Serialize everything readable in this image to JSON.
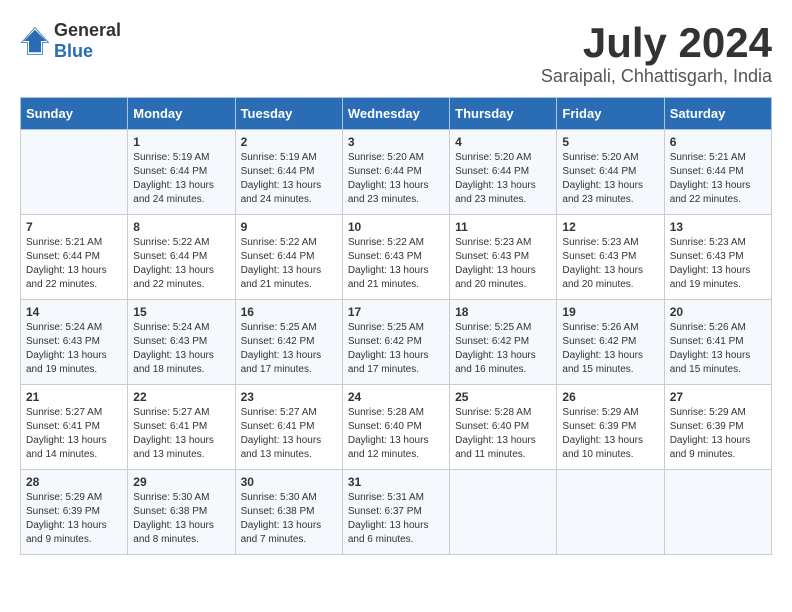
{
  "header": {
    "logo_general": "General",
    "logo_blue": "Blue",
    "month_year": "July 2024",
    "location": "Saraipali, Chhattisgarh, India"
  },
  "days_of_week": [
    "Sunday",
    "Monday",
    "Tuesday",
    "Wednesday",
    "Thursday",
    "Friday",
    "Saturday"
  ],
  "weeks": [
    [
      {
        "day": "",
        "info": ""
      },
      {
        "day": "1",
        "info": "Sunrise: 5:19 AM\nSunset: 6:44 PM\nDaylight: 13 hours\nand 24 minutes."
      },
      {
        "day": "2",
        "info": "Sunrise: 5:19 AM\nSunset: 6:44 PM\nDaylight: 13 hours\nand 24 minutes."
      },
      {
        "day": "3",
        "info": "Sunrise: 5:20 AM\nSunset: 6:44 PM\nDaylight: 13 hours\nand 23 minutes."
      },
      {
        "day": "4",
        "info": "Sunrise: 5:20 AM\nSunset: 6:44 PM\nDaylight: 13 hours\nand 23 minutes."
      },
      {
        "day": "5",
        "info": "Sunrise: 5:20 AM\nSunset: 6:44 PM\nDaylight: 13 hours\nand 23 minutes."
      },
      {
        "day": "6",
        "info": "Sunrise: 5:21 AM\nSunset: 6:44 PM\nDaylight: 13 hours\nand 22 minutes."
      }
    ],
    [
      {
        "day": "7",
        "info": "Sunrise: 5:21 AM\nSunset: 6:44 PM\nDaylight: 13 hours\nand 22 minutes."
      },
      {
        "day": "8",
        "info": "Sunrise: 5:22 AM\nSunset: 6:44 PM\nDaylight: 13 hours\nand 22 minutes."
      },
      {
        "day": "9",
        "info": "Sunrise: 5:22 AM\nSunset: 6:44 PM\nDaylight: 13 hours\nand 21 minutes."
      },
      {
        "day": "10",
        "info": "Sunrise: 5:22 AM\nSunset: 6:43 PM\nDaylight: 13 hours\nand 21 minutes."
      },
      {
        "day": "11",
        "info": "Sunrise: 5:23 AM\nSunset: 6:43 PM\nDaylight: 13 hours\nand 20 minutes."
      },
      {
        "day": "12",
        "info": "Sunrise: 5:23 AM\nSunset: 6:43 PM\nDaylight: 13 hours\nand 20 minutes."
      },
      {
        "day": "13",
        "info": "Sunrise: 5:23 AM\nSunset: 6:43 PM\nDaylight: 13 hours\nand 19 minutes."
      }
    ],
    [
      {
        "day": "14",
        "info": "Sunrise: 5:24 AM\nSunset: 6:43 PM\nDaylight: 13 hours\nand 19 minutes."
      },
      {
        "day": "15",
        "info": "Sunrise: 5:24 AM\nSunset: 6:43 PM\nDaylight: 13 hours\nand 18 minutes."
      },
      {
        "day": "16",
        "info": "Sunrise: 5:25 AM\nSunset: 6:42 PM\nDaylight: 13 hours\nand 17 minutes."
      },
      {
        "day": "17",
        "info": "Sunrise: 5:25 AM\nSunset: 6:42 PM\nDaylight: 13 hours\nand 17 minutes."
      },
      {
        "day": "18",
        "info": "Sunrise: 5:25 AM\nSunset: 6:42 PM\nDaylight: 13 hours\nand 16 minutes."
      },
      {
        "day": "19",
        "info": "Sunrise: 5:26 AM\nSunset: 6:42 PM\nDaylight: 13 hours\nand 15 minutes."
      },
      {
        "day": "20",
        "info": "Sunrise: 5:26 AM\nSunset: 6:41 PM\nDaylight: 13 hours\nand 15 minutes."
      }
    ],
    [
      {
        "day": "21",
        "info": "Sunrise: 5:27 AM\nSunset: 6:41 PM\nDaylight: 13 hours\nand 14 minutes."
      },
      {
        "day": "22",
        "info": "Sunrise: 5:27 AM\nSunset: 6:41 PM\nDaylight: 13 hours\nand 13 minutes."
      },
      {
        "day": "23",
        "info": "Sunrise: 5:27 AM\nSunset: 6:41 PM\nDaylight: 13 hours\nand 13 minutes."
      },
      {
        "day": "24",
        "info": "Sunrise: 5:28 AM\nSunset: 6:40 PM\nDaylight: 13 hours\nand 12 minutes."
      },
      {
        "day": "25",
        "info": "Sunrise: 5:28 AM\nSunset: 6:40 PM\nDaylight: 13 hours\nand 11 minutes."
      },
      {
        "day": "26",
        "info": "Sunrise: 5:29 AM\nSunset: 6:39 PM\nDaylight: 13 hours\nand 10 minutes."
      },
      {
        "day": "27",
        "info": "Sunrise: 5:29 AM\nSunset: 6:39 PM\nDaylight: 13 hours\nand 9 minutes."
      }
    ],
    [
      {
        "day": "28",
        "info": "Sunrise: 5:29 AM\nSunset: 6:39 PM\nDaylight: 13 hours\nand 9 minutes."
      },
      {
        "day": "29",
        "info": "Sunrise: 5:30 AM\nSunset: 6:38 PM\nDaylight: 13 hours\nand 8 minutes."
      },
      {
        "day": "30",
        "info": "Sunrise: 5:30 AM\nSunset: 6:38 PM\nDaylight: 13 hours\nand 7 minutes."
      },
      {
        "day": "31",
        "info": "Sunrise: 5:31 AM\nSunset: 6:37 PM\nDaylight: 13 hours\nand 6 minutes."
      },
      {
        "day": "",
        "info": ""
      },
      {
        "day": "",
        "info": ""
      },
      {
        "day": "",
        "info": ""
      }
    ]
  ]
}
